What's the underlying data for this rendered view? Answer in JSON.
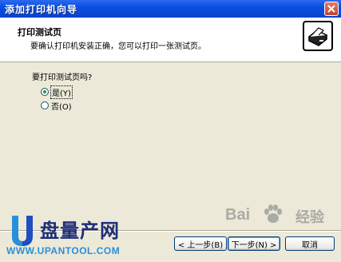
{
  "window": {
    "title": "添加打印机向导"
  },
  "header": {
    "title": "打印测试页",
    "subtitle": "要确认打印机安装正确，您可以打印一张测试页。",
    "icon": "printer-icon"
  },
  "content": {
    "question": "要打印测试页吗?",
    "options": [
      {
        "label": "是(Y)",
        "selected": true
      },
      {
        "label": "否(O)",
        "selected": false
      }
    ]
  },
  "buttons": {
    "back_label": "< 上一步(B)",
    "next_label": "下一步(N) >",
    "cancel_label": "取消"
  },
  "logo": {
    "letter": "U",
    "name": "盘量产网",
    "url": "WWW.UPANTOOL.COM"
  },
  "watermark": {
    "brand_left": "Bai",
    "brand_right": "经验"
  },
  "colors": {
    "title_bar": "#0A4FE0",
    "window_bg": "#ECE9D8",
    "radio_dot": "#21A121",
    "logo_blue": "#1E2D78",
    "url_blue": "#2A8FDB"
  }
}
